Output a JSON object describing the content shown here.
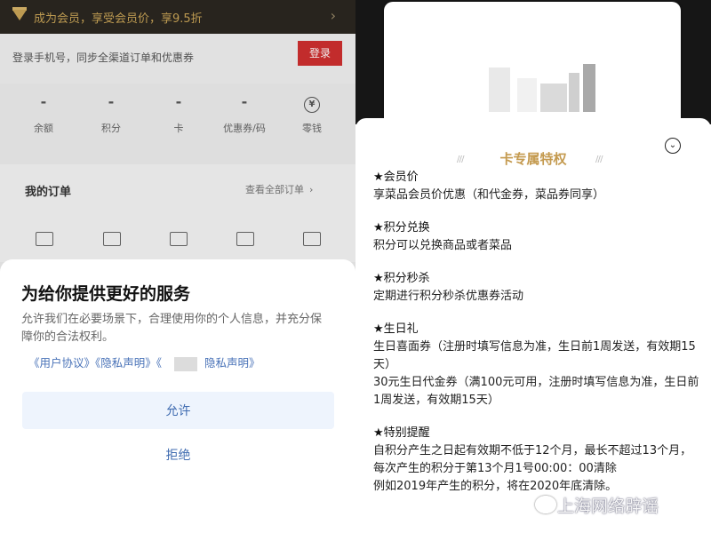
{
  "left": {
    "vip_bar": {
      "text": "成为会员，享受会员价，享9.5折",
      "chevron": "›"
    },
    "login": {
      "prompt": "登录手机号，同步全渠道订单和优惠券",
      "button": "登录"
    },
    "stats": [
      {
        "value": "-",
        "label": "余额"
      },
      {
        "value": "-",
        "label": "积分"
      },
      {
        "value": "-",
        "label": "卡"
      },
      {
        "value": "-",
        "label": "优惠券/码"
      },
      {
        "value": "¥",
        "label": "零钱"
      }
    ],
    "orders": {
      "title": "我的订单",
      "view_all": "查看全部订单",
      "view_all_chevron": "›"
    },
    "consent": {
      "title": "为给你提供更好的服务",
      "body": "允许我们在必要场景下，合理使用你的个人信息，并充分保障你的合法权利。",
      "link_user": "《用户协议》",
      "link_privacy": "《隐私声明》",
      "link_open": "《",
      "link_privacy2": "隐私声明》",
      "allow": "允许",
      "deny": "拒绝"
    }
  },
  "right": {
    "title": "卡专属特权",
    "close_glyph": "⌄",
    "sections": [
      {
        "title": "★会员价",
        "lines": [
          "享菜品会员价优惠（和代金券，菜品券同享）"
        ]
      },
      {
        "title": "★积分兑换",
        "lines": [
          "积分可以兑换商品或者菜品"
        ]
      },
      {
        "title": "★积分秒杀",
        "lines": [
          "定期进行积分秒杀优惠券活动"
        ]
      },
      {
        "title": "★生日礼",
        "lines": [
          "生日喜面券（注册时填写信息为准，生日前1周发送，有效期15天）",
          "30元生日代金券（满100元可用，注册时填写信息为准，生日前1周发送，有效期15天）"
        ]
      },
      {
        "title": "★特别提醒",
        "lines": [
          "自积分产生之日起有效期不低于12个月，最长不超过13个月，每次产生的积分于第13个月1号00:00：00清除",
          "例如2019年产生的积分，将在2020年底清除。"
        ]
      }
    ],
    "watermark": "上海网络辟谣"
  }
}
